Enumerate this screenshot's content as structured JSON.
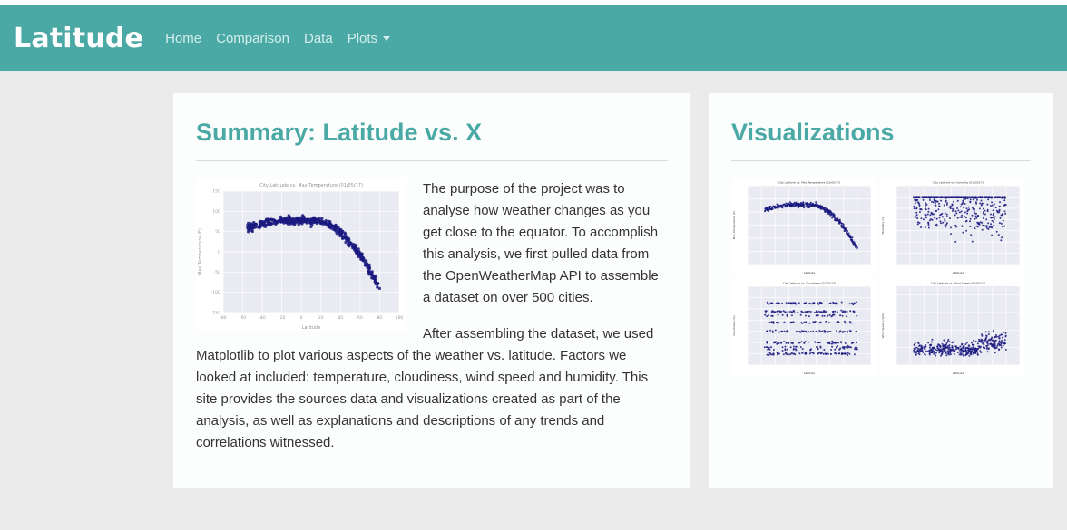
{
  "navbar": {
    "brand": "Latitude",
    "links": [
      "Home",
      "Comparison",
      "Data",
      "Plots"
    ],
    "bg": "#4aa9a5"
  },
  "summary": {
    "title": "Summary: Latitude vs. X",
    "paragraphs": [
      "The purpose of the project was to analyse how weather changes as you get close to the equator. To accomplish this analysis, we first pulled data from the OpenWeatherMap API to assemble a dataset on over 500 cities.",
      "After assembling the dataset, we used Matplotlib to plot various aspects of the weather vs. latitude. Factors we looked at included: temperature, cloudiness, wind speed and humidity. This site provides the sources data and visualizations created as part of the analysis, as well as explanations and descriptions of any trends and correlations witnessed."
    ]
  },
  "main_figure": {
    "title": "City Latitude vs. Max Temperature (01/05/17)",
    "xlabel": "Latitude",
    "ylabel": "Max Temperature (F)",
    "xticks": [
      "-80",
      "-60",
      "-40",
      "-20",
      "0",
      "20",
      "40",
      "60",
      "80",
      "100"
    ],
    "yticks": [
      "150",
      "100",
      "50",
      "0",
      "-50",
      "-100",
      "-150"
    ]
  },
  "visualizations": {
    "title": "Visualizations",
    "thumbs": [
      {
        "title": "City Latitude vs. Max Temperature (01/05/17)",
        "xlabel": "Latitude",
        "ylabel": "Max Temperature (F)",
        "kind": "temp"
      },
      {
        "title": "City Latitude vs. Humidity (01/05/17)",
        "xlabel": "Latitude",
        "ylabel": "Humidity (%)",
        "kind": "humidity"
      },
      {
        "title": "City Latitude vs. Cloudiness (01/05/17)",
        "xlabel": "Latitude",
        "ylabel": "Cloudiness (%)",
        "kind": "cloud"
      },
      {
        "title": "City Latitude vs. Wind Speed (01/05/17)",
        "xlabel": "Latitude",
        "ylabel": "Wind Speed (mph)",
        "kind": "wind"
      }
    ]
  },
  "colors": {
    "accent": "#4aa9a5",
    "plot_bg": "#eaeaf2",
    "point": "#1a1a80"
  }
}
